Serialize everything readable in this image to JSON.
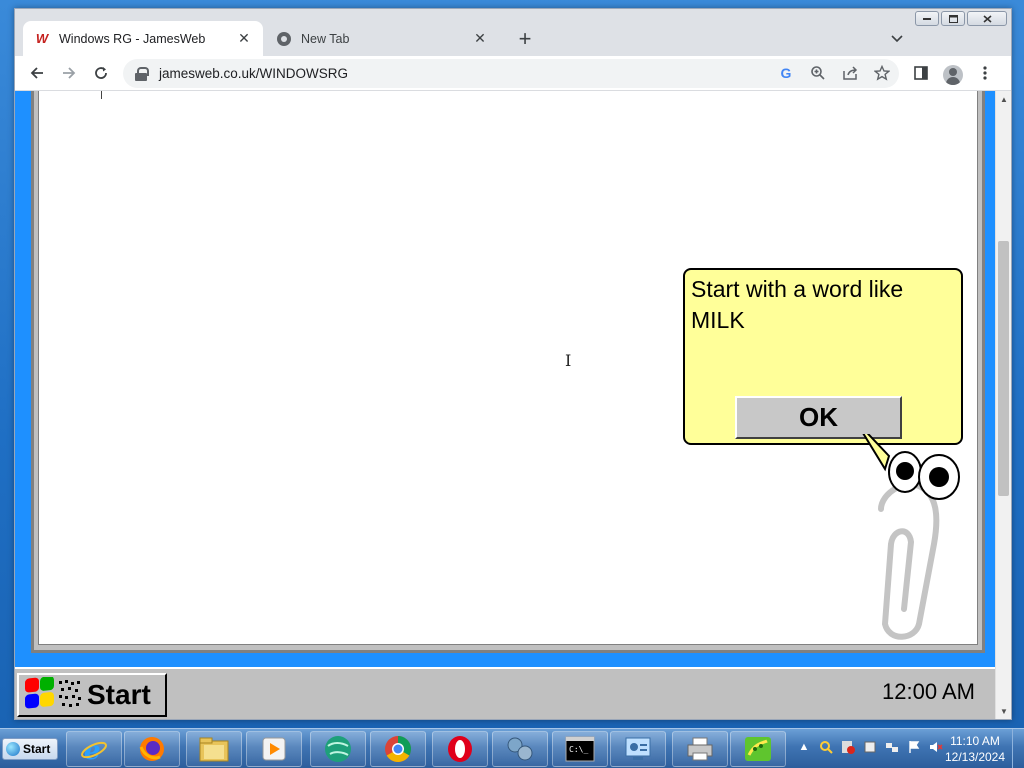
{
  "browser": {
    "tabs": [
      {
        "title": "Windows RG - JamesWeb",
        "active": true
      },
      {
        "title": "New Tab",
        "active": false
      }
    ],
    "new_tab_symbol": "+",
    "close_symbol": "✕",
    "url": "jamesweb.co.uk/WINDOWSRG",
    "window_buttons": [
      "minimize",
      "maximize",
      "close"
    ]
  },
  "page": {
    "dialog": {
      "message": "Start with a word like MILK",
      "ok_label": "OK"
    },
    "taskbar": {
      "start_label": "Start",
      "clock": "12:00 AM"
    }
  },
  "os_taskbar": {
    "start_label": "Start",
    "apps": [
      "internet-explorer",
      "firefox",
      "file-explorer",
      "media-player",
      "green-globe",
      "chrome",
      "opera",
      "network-tool",
      "command-prompt",
      "control-panel",
      "printer",
      "green-app"
    ],
    "time": "11:10 AM",
    "date": "12/13/2024"
  },
  "colors": {
    "bubble": "#ffff99",
    "rg_blue": "#1e90ff",
    "rg_grey": "#c0c0c0"
  }
}
